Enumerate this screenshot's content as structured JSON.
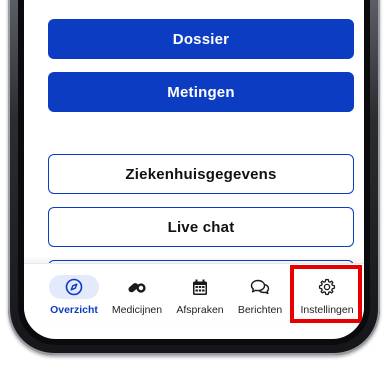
{
  "main": {
    "buttons": [
      {
        "label": "Dossier"
      },
      {
        "label": "Metingen"
      },
      {
        "label": "Ziekenhuisgegevens"
      },
      {
        "label": "Live chat"
      }
    ]
  },
  "tabbar": {
    "active": "Overzicht",
    "items": [
      {
        "label": "Overzicht",
        "icon": "compass-icon"
      },
      {
        "label": "Medicijnen",
        "icon": "pills-icon"
      },
      {
        "label": "Afspraken",
        "icon": "calendar-icon"
      },
      {
        "label": "Berichten",
        "icon": "chat-bubbles-icon"
      },
      {
        "label": "Instellingen",
        "icon": "gear-icon"
      }
    ]
  },
  "annotation": {
    "highlighted_item": "Instellingen",
    "color": "#e80000"
  },
  "colors": {
    "primary": "#0c3cc1",
    "active_tab_bg": "#e3eafb"
  }
}
